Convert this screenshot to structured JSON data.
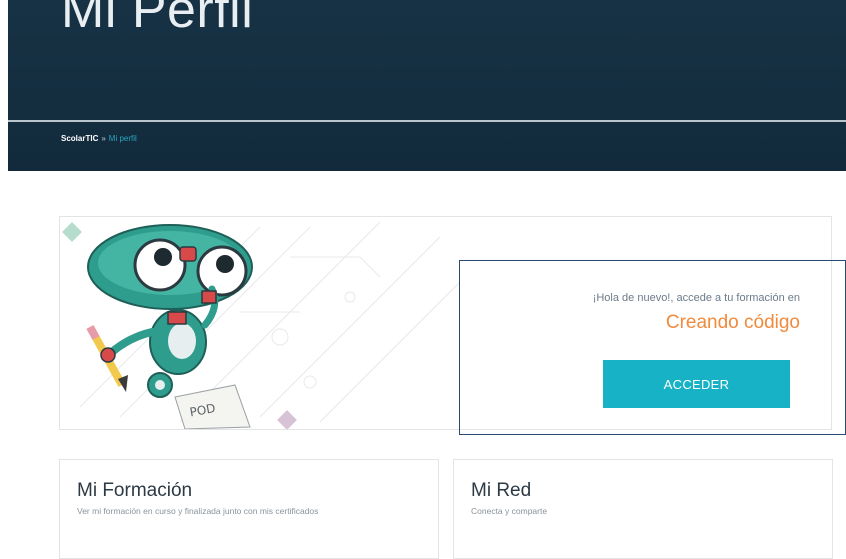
{
  "header": {
    "title": "Mi Perfil",
    "breadcrumb": {
      "root": "ScolarTIC",
      "separator": "»",
      "current": "Mi perfil"
    }
  },
  "welcome": {
    "greeting": "¡Hola de nuevo!, accede a tu formación en",
    "course": "Creando código",
    "button_label": "ACCEDER"
  },
  "cards": [
    {
      "title": "Mi Formación",
      "description": "Ver mi formación en curso y finalizada junto con mis certificados"
    },
    {
      "title": "Mi Red",
      "description": "Conecta y comparte"
    }
  ],
  "colors": {
    "banner": "#142e40",
    "accent": "#17b2c5",
    "course": "#f08a3c",
    "breadcrumb_link": "#2aa7c2"
  }
}
